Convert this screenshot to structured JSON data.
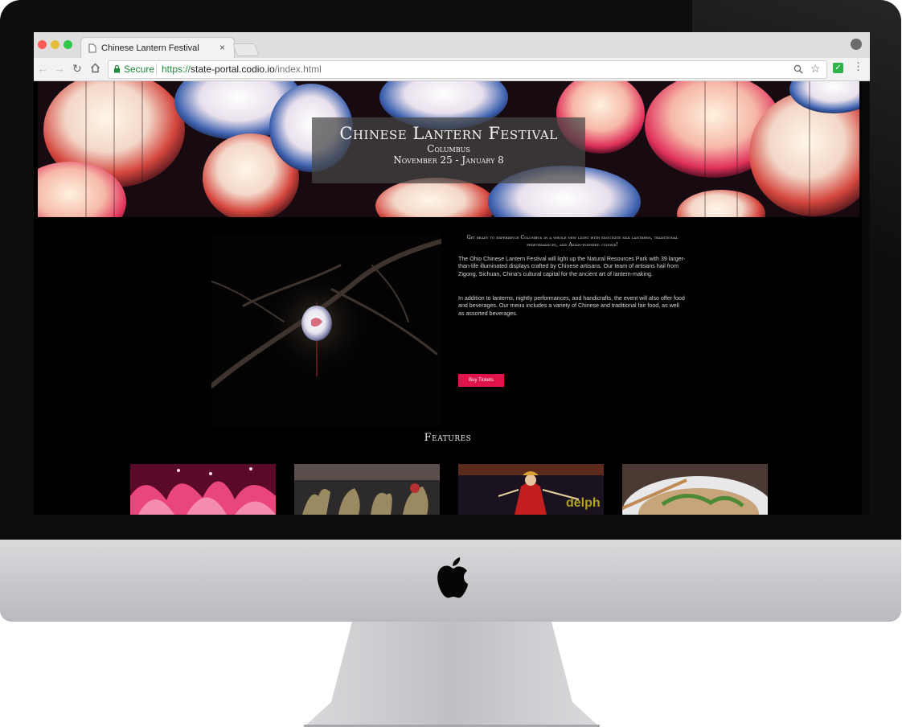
{
  "browser": {
    "tab_title": "Chinese Lantern Festival",
    "tab_close": "×",
    "secure_label": "Secure",
    "url_scheme": "https://",
    "url_host": "state-portal.codio.io",
    "url_path": "/index.html",
    "icons": [
      "page-icon",
      "back-icon",
      "forward-icon",
      "reload-icon",
      "home-icon",
      "lock-icon",
      "zoom-icon",
      "star-icon",
      "extension-check-icon",
      "menu-icon",
      "profile-icon"
    ]
  },
  "hero": {
    "title": "Chinese Lantern Festival",
    "city": "Columbus",
    "dates": "November 25 - January 8"
  },
  "about": {
    "intro": "Get ready to experience Columbus in a whole new light with exquisite silk lanterns, traditional performances, and Asian-inspired cuisine!",
    "paragraph1": "The Ohio Chinese Lantern Festival will light up the Natural Resources Park with 39 larger-than-life illuminated displays crafted by Chinese artisans. Our team of artisans hail from Zigong, Sichuan, China's cultural capital for the ancient art of lantern-making.",
    "paragraph2": "In addition to lanterns, nightly performances, and handicrafts, the event will also offer food and beverages. Our menu includes a variety of Chinese and traditional fair food, as well as assorted beverages.",
    "buy_label": "Buy Tickets"
  },
  "features": {
    "heading": "Features",
    "thumb3_text": "delph"
  },
  "colors": {
    "accent": "#e0134a",
    "secure_green": "#1d8a3a"
  }
}
